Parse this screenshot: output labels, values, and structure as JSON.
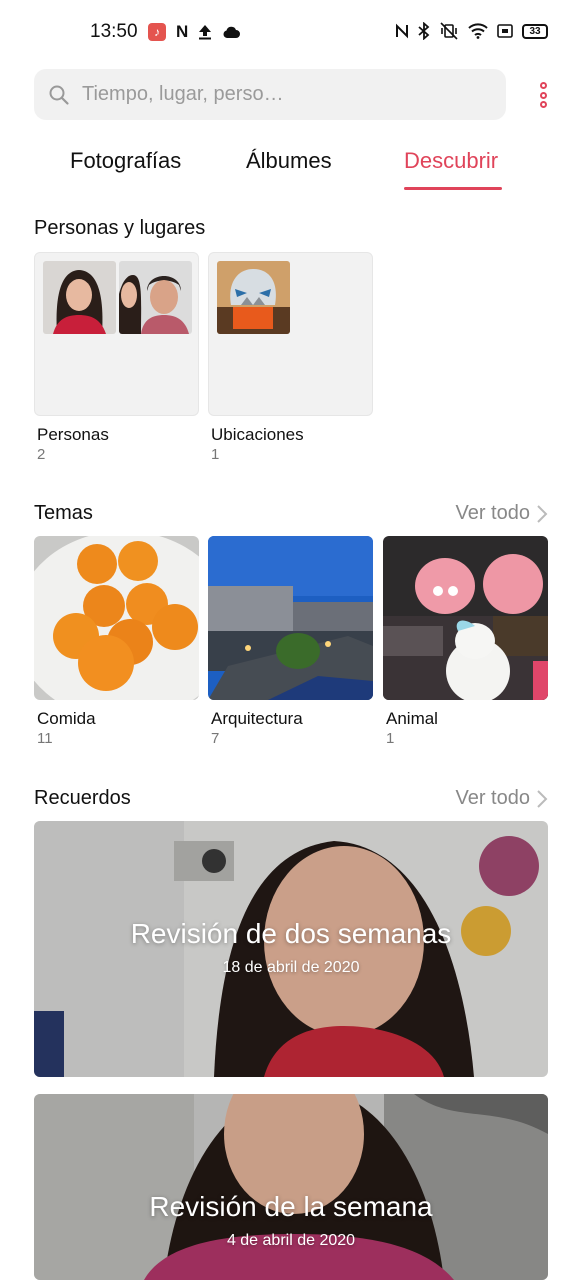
{
  "status_bar": {
    "time": "13:50",
    "left_icons": [
      "music-app-icon",
      "netflix-icon",
      "upload-icon",
      "cloud-icon"
    ],
    "right_icons": [
      "nfc-icon",
      "bluetooth-icon",
      "vibrate-off-icon",
      "wifi-icon",
      "cast-icon"
    ],
    "battery": "33"
  },
  "search": {
    "placeholder": "Tiempo, lugar, perso…"
  },
  "tabs": [
    {
      "label": "Fotografías",
      "active": false
    },
    {
      "label": "Álbumes",
      "active": false
    },
    {
      "label": "Descubrir",
      "active": true
    }
  ],
  "accent_color": "#e0445a",
  "people_places": {
    "title": "Personas y lugares",
    "cards": [
      {
        "label": "Personas",
        "count": "2"
      },
      {
        "label": "Ubicaciones",
        "count": "1"
      }
    ]
  },
  "themes": {
    "title": "Temas",
    "see_all": "Ver todo",
    "items": [
      {
        "label": "Comida",
        "count": "11"
      },
      {
        "label": "Arquitectura",
        "count": "7"
      },
      {
        "label": "Animal",
        "count": "1"
      }
    ]
  },
  "memories": {
    "title": "Recuerdos",
    "see_all": "Ver todo",
    "items": [
      {
        "title": "Revisión de dos semanas",
        "date": "18 de abril de 2020"
      },
      {
        "title": "Revisión de la semana",
        "date": "4 de abril de 2020"
      }
    ]
  }
}
